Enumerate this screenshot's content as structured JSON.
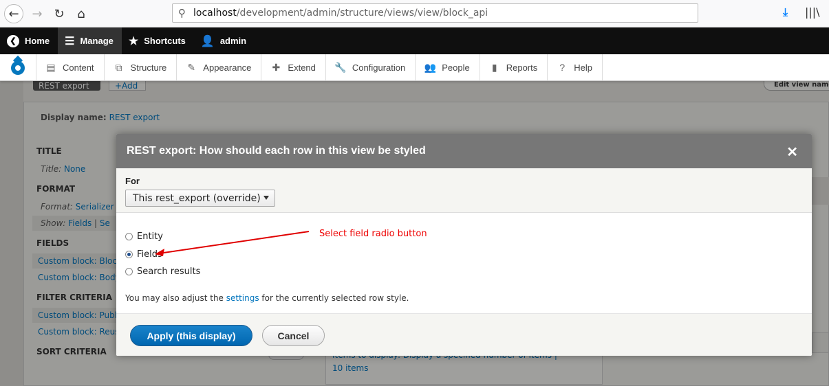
{
  "browser": {
    "url_host": "localhost",
    "url_path": "/development/admin/structure/views/view/block_api"
  },
  "toolbar": {
    "home": "Home",
    "manage": "Manage",
    "shortcuts": "Shortcuts",
    "user": "admin"
  },
  "tray": {
    "items": [
      "Content",
      "Structure",
      "Appearance",
      "Extend",
      "Configuration",
      "People",
      "Reports",
      "Help"
    ]
  },
  "background": {
    "tab": "REST export",
    "add": "+Add",
    "edit_view": "Edit view name/",
    "display_name_label": "Display name:",
    "display_name_value": "REST export",
    "title_heading": "TITLE",
    "title_label": "Title:",
    "title_value": "None",
    "format_heading": "FORMAT",
    "format_label": "Format:",
    "format_value": "Serializer",
    "show_label": "Show:",
    "show_value": "Fields",
    "show_sep": "|",
    "show_more": "Se",
    "fields_heading": "FIELDS",
    "field_1": "Custom block: Block",
    "field_2": "Custom block: Body",
    "filter_heading": "FILTER CRITERIA",
    "filter_1": "Custom block: Publ",
    "filter_2": "Custom block: Reus",
    "sort_heading": "SORT CRITERIA",
    "items_text": "Items to display: Display a specified number of items",
    "items_sep": "|",
    "items_count": "10 items"
  },
  "dialog": {
    "title": "REST export: How should each row in this view be styled",
    "close_glyph": "✕",
    "for_label": "For",
    "for_select": "This rest_export (override)",
    "options": [
      {
        "label": "Entity",
        "checked": false
      },
      {
        "label": "Fields",
        "checked": true
      },
      {
        "label": "Search results",
        "checked": false
      }
    ],
    "note_pre": "You may also adjust the ",
    "note_link": "settings",
    "note_post": " for the currently selected row style.",
    "annotation": "Select field radio button",
    "annotation_color": "#e00000",
    "apply": "Apply (this display)",
    "cancel": "Cancel"
  }
}
